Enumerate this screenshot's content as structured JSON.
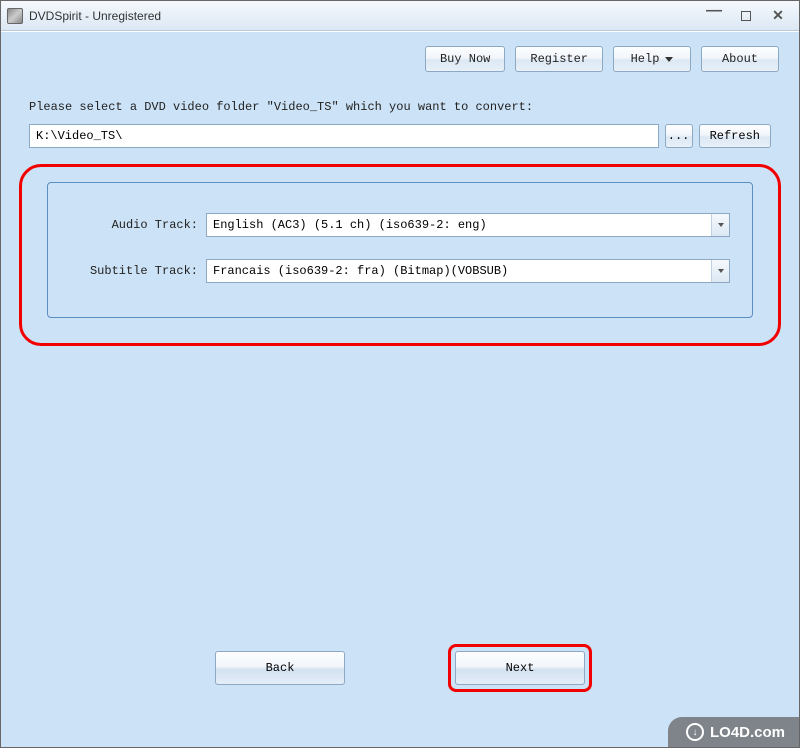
{
  "window": {
    "title": "DVDSpirit - Unregistered"
  },
  "toolbar": {
    "buy_now": "Buy Now",
    "register": "Register",
    "help": "Help",
    "about": "About"
  },
  "main": {
    "prompt": "Please select a DVD video folder \"Video_TS\" which you want to convert:",
    "path_value": "K:\\Video_TS\\",
    "browse_label": "...",
    "refresh_label": "Refresh"
  },
  "tracks": {
    "audio_label": "Audio Track:",
    "audio_value": "English (AC3) (5.1 ch) (iso639-2: eng)",
    "subtitle_label": "Subtitle Track:",
    "subtitle_value": "Francais (iso639-2: fra) (Bitmap)(VOBSUB)"
  },
  "nav": {
    "back": "Back",
    "next": "Next"
  },
  "watermark": {
    "text": "LO4D.com"
  }
}
